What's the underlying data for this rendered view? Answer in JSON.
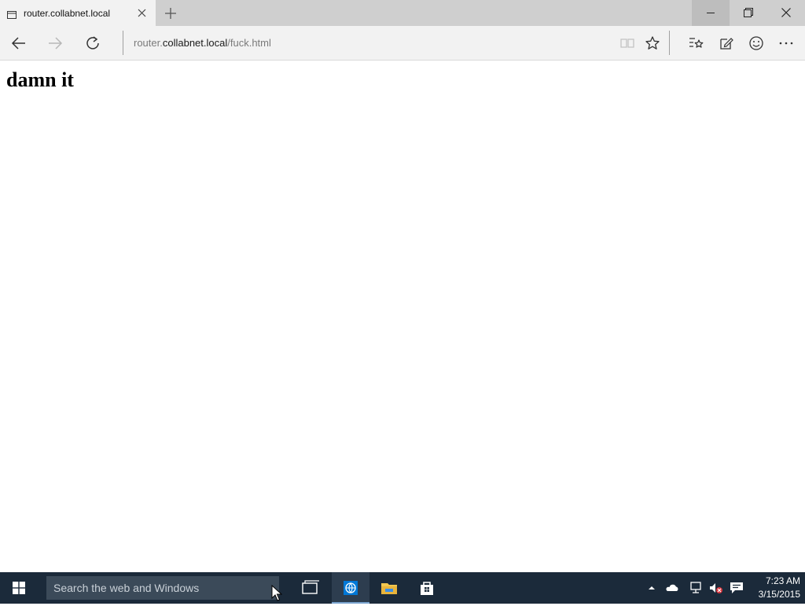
{
  "browser": {
    "tab": {
      "title": "router.collabnet.local"
    },
    "address": {
      "prefix": "router.",
      "host": "collabnet.local",
      "path": "/fuck.html"
    }
  },
  "page": {
    "heading": "damn it"
  },
  "taskbar": {
    "search_placeholder": "Search the web and Windows",
    "clock": {
      "time": "7:23 AM",
      "date": "3/15/2015"
    }
  },
  "colors": {
    "tab_strip": "#cfcfcf",
    "toolbar": "#f2f2f2",
    "taskbar": "#1b2a3a",
    "accent": "#0078d7"
  }
}
